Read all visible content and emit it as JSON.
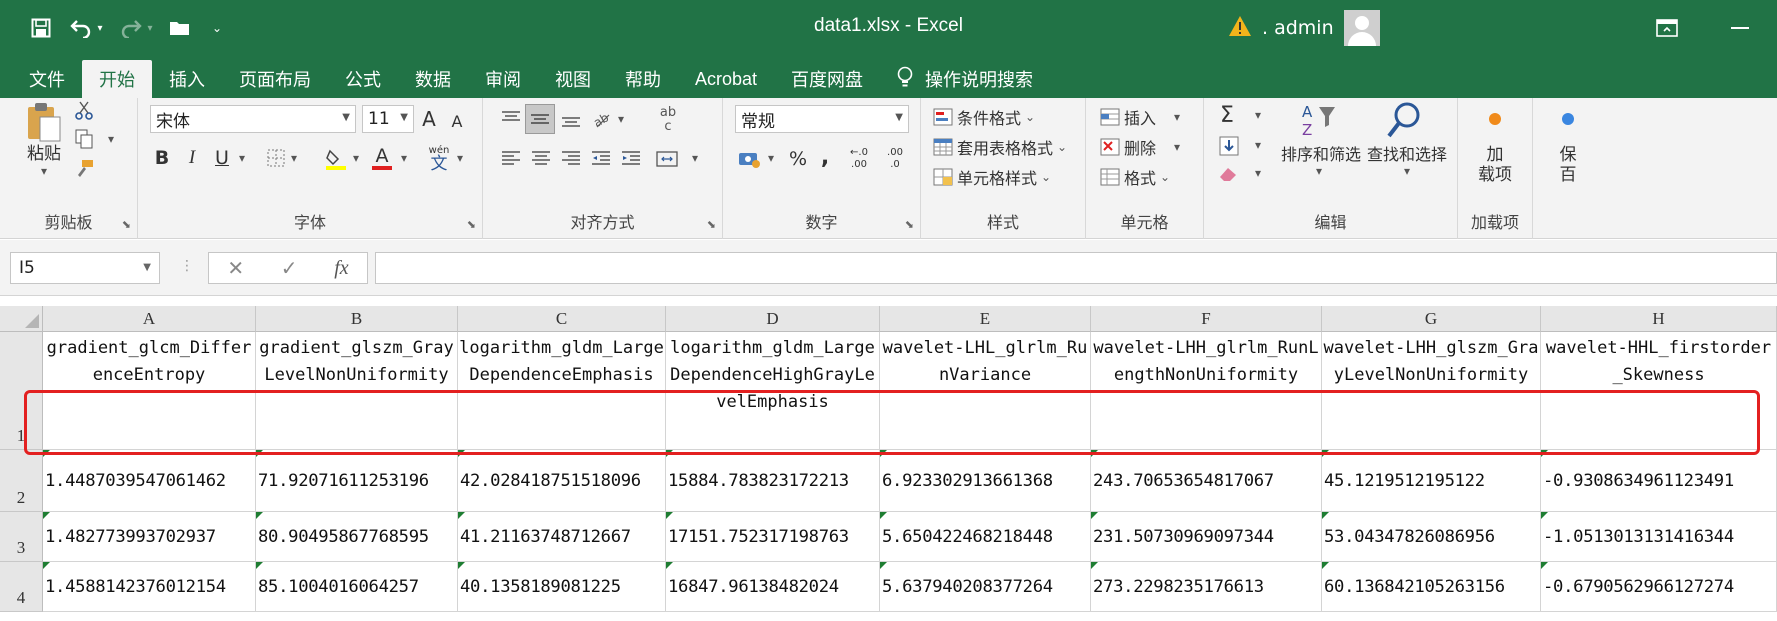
{
  "window": {
    "title": "data1.xlsx  -  Excel",
    "user": ". admin",
    "warning_icon": "warning-icon"
  },
  "tabs": [
    "文件",
    "开始",
    "插入",
    "页面布局",
    "公式",
    "数据",
    "审阅",
    "视图",
    "帮助",
    "Acrobat",
    "百度网盘",
    "操作说明搜索"
  ],
  "active_tab": "开始",
  "ribbon": {
    "clipboard": {
      "paste": "粘贴",
      "label": "剪贴板"
    },
    "font": {
      "name": "宋体",
      "size": "11",
      "bold": "B",
      "italic": "I",
      "underline": "U",
      "wen": "wén",
      "wen_char": "文",
      "grow": "A",
      "shrink": "A",
      "label": "字体"
    },
    "align": {
      "label": "对齐方式",
      "wrap_top": "ab",
      "wrap_bottom": "c"
    },
    "number": {
      "format": "常规",
      "percent": "%",
      "comma": ",",
      "inc": ".00",
      "dec": ".0",
      "label": "数字"
    },
    "styles": {
      "conditional": "条件格式",
      "table": "套用表格格式",
      "cell": "单元格样式",
      "label": "样式"
    },
    "cells": {
      "insert": "插入",
      "delete": "删除",
      "format": "格式",
      "label": "单元格"
    },
    "editing": {
      "sort": "排序和筛选",
      "find": "查找和选择",
      "sigma": "Σ",
      "label": "编辑"
    },
    "addins": {
      "line1": "加",
      "line2": "载项",
      "label": "加载项"
    },
    "extra": {
      "line1": "保",
      "line2": "百"
    }
  },
  "formula_bar": {
    "name_box": "I5",
    "cancel": "✕",
    "enter": "✓",
    "fx": "fx",
    "value": ""
  },
  "columns": [
    "A",
    "B",
    "C",
    "D",
    "E",
    "F",
    "G",
    "H"
  ],
  "rows": [
    "1",
    "2",
    "3",
    "4"
  ],
  "headers": [
    "gradient_glcm_DifferenceEntropy",
    "gradient_glszm_GrayLevelNonUniformity",
    "logarithm_gldm_LargeDependenceEmphasis",
    "logarithm_gldm_LargeDependenceHighGrayLevelEmphasis",
    "wavelet-LHL_glrlm_RunVariance",
    "wavelet-LHH_glrlm_RunLengthNonUniformity",
    "wavelet-LHH_glszm_GrayLevelNonUniformity",
    "wavelet-HHL_firstorder_Skewness"
  ],
  "data": [
    [
      "1.4487039547061462",
      "71.92071611253196",
      "42.028418751518096",
      "15884.783823172213",
      "6.923302913661368",
      "243.70653654817067",
      "45.1219512195122",
      "-0.9308634961123491"
    ],
    [
      "1.482773993702937",
      "80.90495867768595",
      "41.21163748712667",
      "17151.752317198763",
      "5.650422468218448",
      "231.50730969097344",
      "53.04347826086956",
      "-1.0513013131416344"
    ],
    [
      "1.4588142376012154",
      "85.1004016064257",
      "40.1358189081225",
      "16847.96138482024",
      "5.637940208377264",
      "273.2298235176613",
      "60.136842105263156",
      "-0.6790562966127274"
    ]
  ],
  "highlighted_row": "2"
}
